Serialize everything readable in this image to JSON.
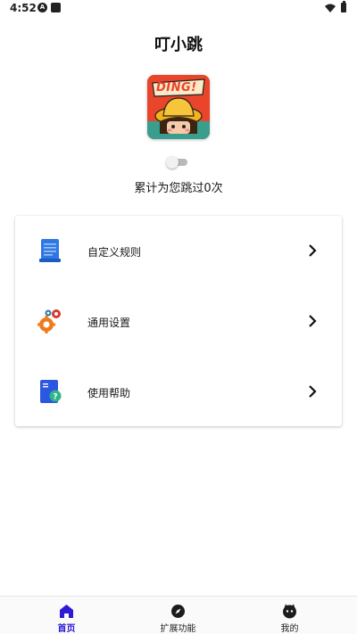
{
  "status_bar": {
    "time": "4:52",
    "left_icon_a": "A",
    "icons": [
      "notification-a-icon",
      "notification-b-icon",
      "wifi-icon",
      "battery-icon"
    ]
  },
  "app": {
    "title": "叮小跳",
    "logo_text": "DING!"
  },
  "toggle": {
    "state": "off"
  },
  "skip_count_text": "累计为您跳过0次",
  "menu": [
    {
      "label": "自定义规则",
      "icon": "document-icon"
    },
    {
      "label": "通用设置",
      "icon": "gears-icon"
    },
    {
      "label": "使用帮助",
      "icon": "help-book-icon"
    }
  ],
  "bottom_nav": [
    {
      "label": "首页",
      "icon": "home-icon",
      "active": true
    },
    {
      "label": "扩展功能",
      "icon": "compass-icon",
      "active": false
    },
    {
      "label": "我的",
      "icon": "profile-icon",
      "active": false
    }
  ],
  "colors": {
    "accent": "#2d19d6",
    "logo_bg": "#e8452b"
  }
}
